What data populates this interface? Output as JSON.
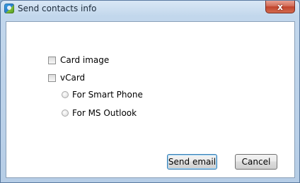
{
  "window": {
    "title": "Send contacts info",
    "close_glyph": "x",
    "icon": "app-icon"
  },
  "options": {
    "card_image": {
      "label": "Card image",
      "checked": false
    },
    "vcard": {
      "label": "vCard",
      "checked": false
    },
    "smart_phone": {
      "label": "For Smart Phone",
      "selected": false
    },
    "ms_outlook": {
      "label": "For MS Outlook",
      "selected": false
    }
  },
  "buttons": {
    "send_email": "Send email",
    "cancel": "Cancel"
  },
  "colors": {
    "close_button": "#c0432d",
    "client_background": "#ffffff"
  }
}
